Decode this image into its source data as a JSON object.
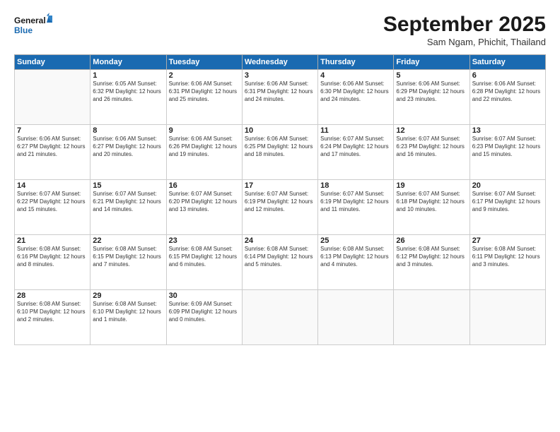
{
  "header": {
    "logo_line1": "General",
    "logo_line2": "Blue",
    "month": "September 2025",
    "location": "Sam Ngam, Phichit, Thailand"
  },
  "weekdays": [
    "Sunday",
    "Monday",
    "Tuesday",
    "Wednesday",
    "Thursday",
    "Friday",
    "Saturday"
  ],
  "weeks": [
    [
      {
        "day": "",
        "info": ""
      },
      {
        "day": "1",
        "info": "Sunrise: 6:05 AM\nSunset: 6:32 PM\nDaylight: 12 hours\nand 26 minutes."
      },
      {
        "day": "2",
        "info": "Sunrise: 6:06 AM\nSunset: 6:31 PM\nDaylight: 12 hours\nand 25 minutes."
      },
      {
        "day": "3",
        "info": "Sunrise: 6:06 AM\nSunset: 6:31 PM\nDaylight: 12 hours\nand 24 minutes."
      },
      {
        "day": "4",
        "info": "Sunrise: 6:06 AM\nSunset: 6:30 PM\nDaylight: 12 hours\nand 24 minutes."
      },
      {
        "day": "5",
        "info": "Sunrise: 6:06 AM\nSunset: 6:29 PM\nDaylight: 12 hours\nand 23 minutes."
      },
      {
        "day": "6",
        "info": "Sunrise: 6:06 AM\nSunset: 6:28 PM\nDaylight: 12 hours\nand 22 minutes."
      }
    ],
    [
      {
        "day": "7",
        "info": "Sunrise: 6:06 AM\nSunset: 6:27 PM\nDaylight: 12 hours\nand 21 minutes."
      },
      {
        "day": "8",
        "info": "Sunrise: 6:06 AM\nSunset: 6:27 PM\nDaylight: 12 hours\nand 20 minutes."
      },
      {
        "day": "9",
        "info": "Sunrise: 6:06 AM\nSunset: 6:26 PM\nDaylight: 12 hours\nand 19 minutes."
      },
      {
        "day": "10",
        "info": "Sunrise: 6:06 AM\nSunset: 6:25 PM\nDaylight: 12 hours\nand 18 minutes."
      },
      {
        "day": "11",
        "info": "Sunrise: 6:07 AM\nSunset: 6:24 PM\nDaylight: 12 hours\nand 17 minutes."
      },
      {
        "day": "12",
        "info": "Sunrise: 6:07 AM\nSunset: 6:23 PM\nDaylight: 12 hours\nand 16 minutes."
      },
      {
        "day": "13",
        "info": "Sunrise: 6:07 AM\nSunset: 6:23 PM\nDaylight: 12 hours\nand 15 minutes."
      }
    ],
    [
      {
        "day": "14",
        "info": "Sunrise: 6:07 AM\nSunset: 6:22 PM\nDaylight: 12 hours\nand 15 minutes."
      },
      {
        "day": "15",
        "info": "Sunrise: 6:07 AM\nSunset: 6:21 PM\nDaylight: 12 hours\nand 14 minutes."
      },
      {
        "day": "16",
        "info": "Sunrise: 6:07 AM\nSunset: 6:20 PM\nDaylight: 12 hours\nand 13 minutes."
      },
      {
        "day": "17",
        "info": "Sunrise: 6:07 AM\nSunset: 6:19 PM\nDaylight: 12 hours\nand 12 minutes."
      },
      {
        "day": "18",
        "info": "Sunrise: 6:07 AM\nSunset: 6:19 PM\nDaylight: 12 hours\nand 11 minutes."
      },
      {
        "day": "19",
        "info": "Sunrise: 6:07 AM\nSunset: 6:18 PM\nDaylight: 12 hours\nand 10 minutes."
      },
      {
        "day": "20",
        "info": "Sunrise: 6:07 AM\nSunset: 6:17 PM\nDaylight: 12 hours\nand 9 minutes."
      }
    ],
    [
      {
        "day": "21",
        "info": "Sunrise: 6:08 AM\nSunset: 6:16 PM\nDaylight: 12 hours\nand 8 minutes."
      },
      {
        "day": "22",
        "info": "Sunrise: 6:08 AM\nSunset: 6:15 PM\nDaylight: 12 hours\nand 7 minutes."
      },
      {
        "day": "23",
        "info": "Sunrise: 6:08 AM\nSunset: 6:15 PM\nDaylight: 12 hours\nand 6 minutes."
      },
      {
        "day": "24",
        "info": "Sunrise: 6:08 AM\nSunset: 6:14 PM\nDaylight: 12 hours\nand 5 minutes."
      },
      {
        "day": "25",
        "info": "Sunrise: 6:08 AM\nSunset: 6:13 PM\nDaylight: 12 hours\nand 4 minutes."
      },
      {
        "day": "26",
        "info": "Sunrise: 6:08 AM\nSunset: 6:12 PM\nDaylight: 12 hours\nand 3 minutes."
      },
      {
        "day": "27",
        "info": "Sunrise: 6:08 AM\nSunset: 6:11 PM\nDaylight: 12 hours\nand 3 minutes."
      }
    ],
    [
      {
        "day": "28",
        "info": "Sunrise: 6:08 AM\nSunset: 6:10 PM\nDaylight: 12 hours\nand 2 minutes."
      },
      {
        "day": "29",
        "info": "Sunrise: 6:08 AM\nSunset: 6:10 PM\nDaylight: 12 hours\nand 1 minute."
      },
      {
        "day": "30",
        "info": "Sunrise: 6:09 AM\nSunset: 6:09 PM\nDaylight: 12 hours\nand 0 minutes."
      },
      {
        "day": "",
        "info": ""
      },
      {
        "day": "",
        "info": ""
      },
      {
        "day": "",
        "info": ""
      },
      {
        "day": "",
        "info": ""
      }
    ]
  ]
}
